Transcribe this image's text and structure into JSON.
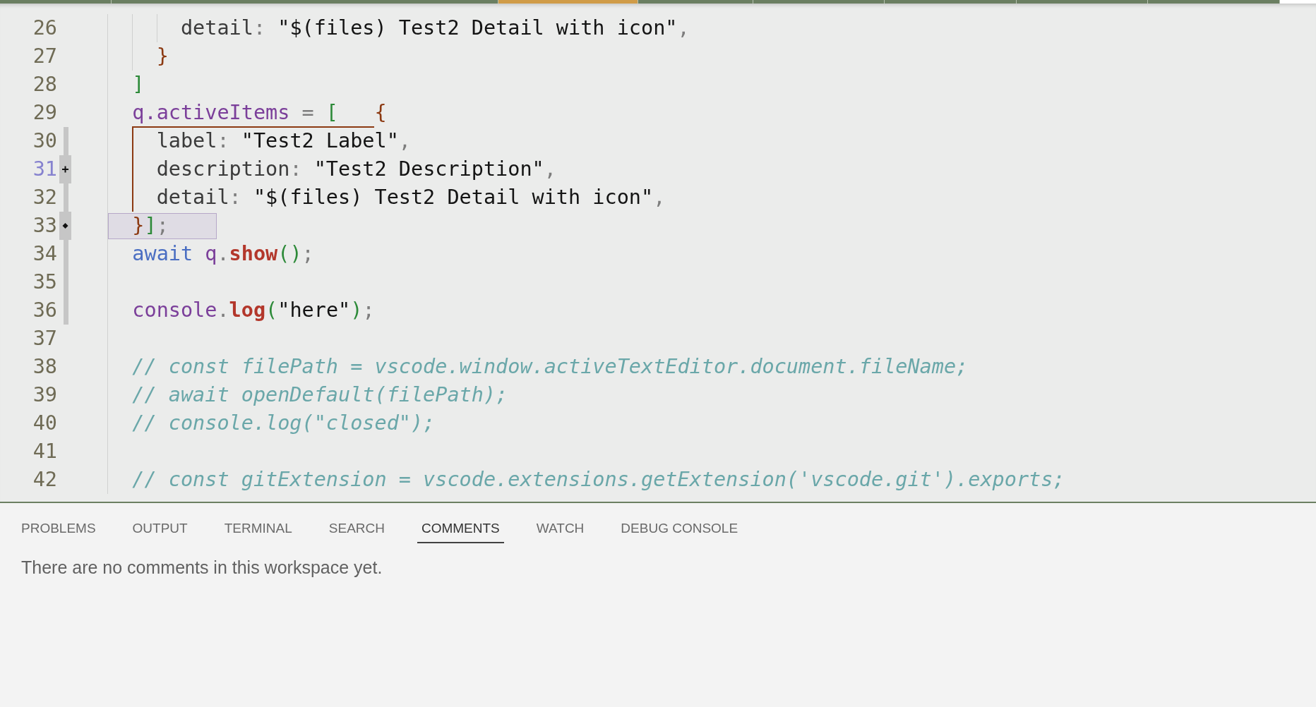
{
  "editor_tabs": [
    {
      "selected": false
    },
    {
      "selected": false
    },
    {
      "selected": true
    },
    {
      "selected": false
    },
    {
      "selected": false
    },
    {
      "selected": false
    },
    {
      "selected": false
    },
    {
      "selected": false
    }
  ],
  "editor": {
    "lines": [
      {
        "number": "26",
        "active": false,
        "highlighted": false,
        "bracket_guide": false,
        "gutter_bar": false,
        "plus_mark": false,
        "diamond_mark": false,
        "tokens": [
          {
            "text": "      detail",
            "kind": "property"
          },
          {
            "text": ": ",
            "kind": "punct"
          },
          {
            "text": "\"$(files) Test2 Detail with icon\"",
            "kind": "string"
          },
          {
            "text": ",",
            "kind": "punct"
          }
        ]
      },
      {
        "number": "27",
        "active": false,
        "highlighted": false,
        "bracket_guide": false,
        "gutter_bar": false,
        "plus_mark": false,
        "diamond_mark": false,
        "tokens": [
          {
            "text": "    }",
            "kind": "brace"
          }
        ]
      },
      {
        "number": "28",
        "active": false,
        "highlighted": false,
        "bracket_guide": false,
        "gutter_bar": false,
        "plus_mark": false,
        "diamond_mark": false,
        "tokens": [
          {
            "text": "  ]",
            "kind": "bracket"
          }
        ]
      },
      {
        "number": "29",
        "active": false,
        "highlighted": false,
        "bracket_guide": false,
        "gutter_bar": false,
        "plus_mark": false,
        "diamond_mark": false,
        "tokens": [
          {
            "text": "  q.activeItems",
            "kind": "variable"
          },
          {
            "text": " = ",
            "kind": "punct"
          },
          {
            "text": "[   ",
            "kind": "bracket"
          },
          {
            "text": "{",
            "kind": "brace"
          }
        ]
      },
      {
        "number": "30",
        "active": false,
        "highlighted": false,
        "bracket_guide": true,
        "gutter_bar": true,
        "plus_mark": false,
        "diamond_mark": false,
        "tokens": [
          {
            "text": "    label",
            "kind": "property"
          },
          {
            "text": ": ",
            "kind": "punct"
          },
          {
            "text": "\"Test2 Label\"",
            "kind": "string"
          },
          {
            "text": ",",
            "kind": "punct"
          }
        ]
      },
      {
        "number": "31",
        "active": true,
        "highlighted": false,
        "bracket_guide": true,
        "gutter_bar": false,
        "plus_mark": true,
        "diamond_mark": false,
        "tokens": [
          {
            "text": "    description",
            "kind": "property"
          },
          {
            "text": ": ",
            "kind": "punct"
          },
          {
            "text": "\"Test2 Description\"",
            "kind": "string"
          },
          {
            "text": ",",
            "kind": "punct"
          }
        ]
      },
      {
        "number": "32",
        "active": false,
        "highlighted": false,
        "bracket_guide": true,
        "gutter_bar": true,
        "plus_mark": false,
        "diamond_mark": false,
        "tokens": [
          {
            "text": "    detail",
            "kind": "property"
          },
          {
            "text": ": ",
            "kind": "punct"
          },
          {
            "text": "\"$(files) Test2 Detail with icon\"",
            "kind": "string"
          },
          {
            "text": ",",
            "kind": "punct"
          }
        ]
      },
      {
        "number": "33",
        "active": false,
        "highlighted": true,
        "bracket_guide": false,
        "gutter_bar": false,
        "plus_mark": false,
        "diamond_mark": true,
        "tokens": [
          {
            "text": "  }",
            "kind": "brace"
          },
          {
            "text": "]",
            "kind": "bracket"
          },
          {
            "text": ";",
            "kind": "punct"
          }
        ]
      },
      {
        "number": "34",
        "active": false,
        "highlighted": false,
        "bracket_guide": false,
        "gutter_bar": true,
        "plus_mark": false,
        "diamond_mark": false,
        "tokens": [
          {
            "text": "  await ",
            "kind": "keyword"
          },
          {
            "text": "q",
            "kind": "variable"
          },
          {
            "text": ".",
            "kind": "punct"
          },
          {
            "text": "show",
            "kind": "method"
          },
          {
            "text": "()",
            "kind": "bracket"
          },
          {
            "text": ";",
            "kind": "punct"
          }
        ]
      },
      {
        "number": "35",
        "active": false,
        "highlighted": false,
        "bracket_guide": false,
        "gutter_bar": true,
        "plus_mark": false,
        "diamond_mark": false
      },
      {
        "number": "36",
        "active": false,
        "highlighted": false,
        "bracket_guide": false,
        "gutter_bar": true,
        "plus_mark": false,
        "diamond_mark": false,
        "tokens": [
          {
            "text": "  console",
            "kind": "variable"
          },
          {
            "text": ".",
            "kind": "punct"
          },
          {
            "text": "log",
            "kind": "method"
          },
          {
            "text": "(",
            "kind": "bracket"
          },
          {
            "text": "\"here\"",
            "kind": "string"
          },
          {
            "text": ")",
            "kind": "bracket"
          },
          {
            "text": ";",
            "kind": "punct"
          }
        ]
      },
      {
        "number": "37",
        "active": false,
        "highlighted": false,
        "bracket_guide": false,
        "gutter_bar": false,
        "plus_mark": false,
        "diamond_mark": false
      },
      {
        "number": "38",
        "active": false,
        "highlighted": false,
        "bracket_guide": false,
        "gutter_bar": false,
        "plus_mark": false,
        "diamond_mark": false,
        "tokens": [
          {
            "text": "  // const filePath = vscode.window.activeTextEditor.document.fileName;",
            "kind": "comment"
          }
        ]
      },
      {
        "number": "39",
        "active": false,
        "highlighted": false,
        "bracket_guide": false,
        "gutter_bar": false,
        "plus_mark": false,
        "diamond_mark": false,
        "tokens": [
          {
            "text": "  // await openDefault(filePath);",
            "kind": "comment"
          }
        ]
      },
      {
        "number": "40",
        "active": false,
        "highlighted": false,
        "bracket_guide": false,
        "gutter_bar": false,
        "plus_mark": false,
        "diamond_mark": false,
        "tokens": [
          {
            "text": "  // console.log(\"closed\");",
            "kind": "comment"
          }
        ]
      },
      {
        "number": "41",
        "active": false,
        "highlighted": false,
        "bracket_guide": false,
        "gutter_bar": false,
        "plus_mark": false,
        "diamond_mark": false
      },
      {
        "number": "42",
        "active": false,
        "highlighted": false,
        "bracket_guide": false,
        "gutter_bar": false,
        "plus_mark": false,
        "diamond_mark": false,
        "tokens": [
          {
            "text": "  // const gitExtension = vscode.extensions.getExtension('vscode.git').exports;",
            "kind": "comment"
          }
        ]
      }
    ]
  },
  "panel": {
    "tabs": [
      {
        "label": "PROBLEMS",
        "selected": false
      },
      {
        "label": "OUTPUT",
        "selected": false
      },
      {
        "label": "TERMINAL",
        "selected": false
      },
      {
        "label": "SEARCH",
        "selected": false
      },
      {
        "label": "COMMENTS",
        "selected": true
      },
      {
        "label": "WATCH",
        "selected": false
      },
      {
        "label": "DEBUG CONSOLE",
        "selected": false
      }
    ],
    "message": "There are no comments in this workspace yet."
  }
}
